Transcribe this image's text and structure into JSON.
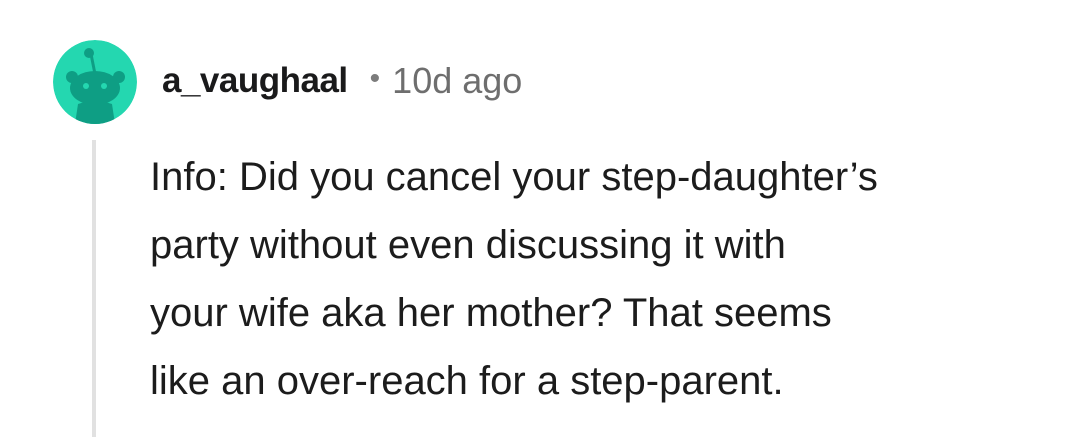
{
  "comment": {
    "username": "a_vaughaal",
    "separator": "•",
    "timestamp": "10d ago",
    "body_lines": [
      "Info: Did you cancel your step-daughter’s",
      "party without even discussing it with",
      "your wife aka her mother? That seems",
      "like an over-reach for a step-parent."
    ]
  },
  "avatar": {
    "icon": "snoo-avatar-icon",
    "background_color": "#24d7b0",
    "figure_color": "#0e9e84"
  },
  "colors": {
    "username": "#1a1a1b",
    "timestamp": "#6e6e6e",
    "body_text": "#1c1c1c",
    "thread_line": "#e1e1e1"
  }
}
